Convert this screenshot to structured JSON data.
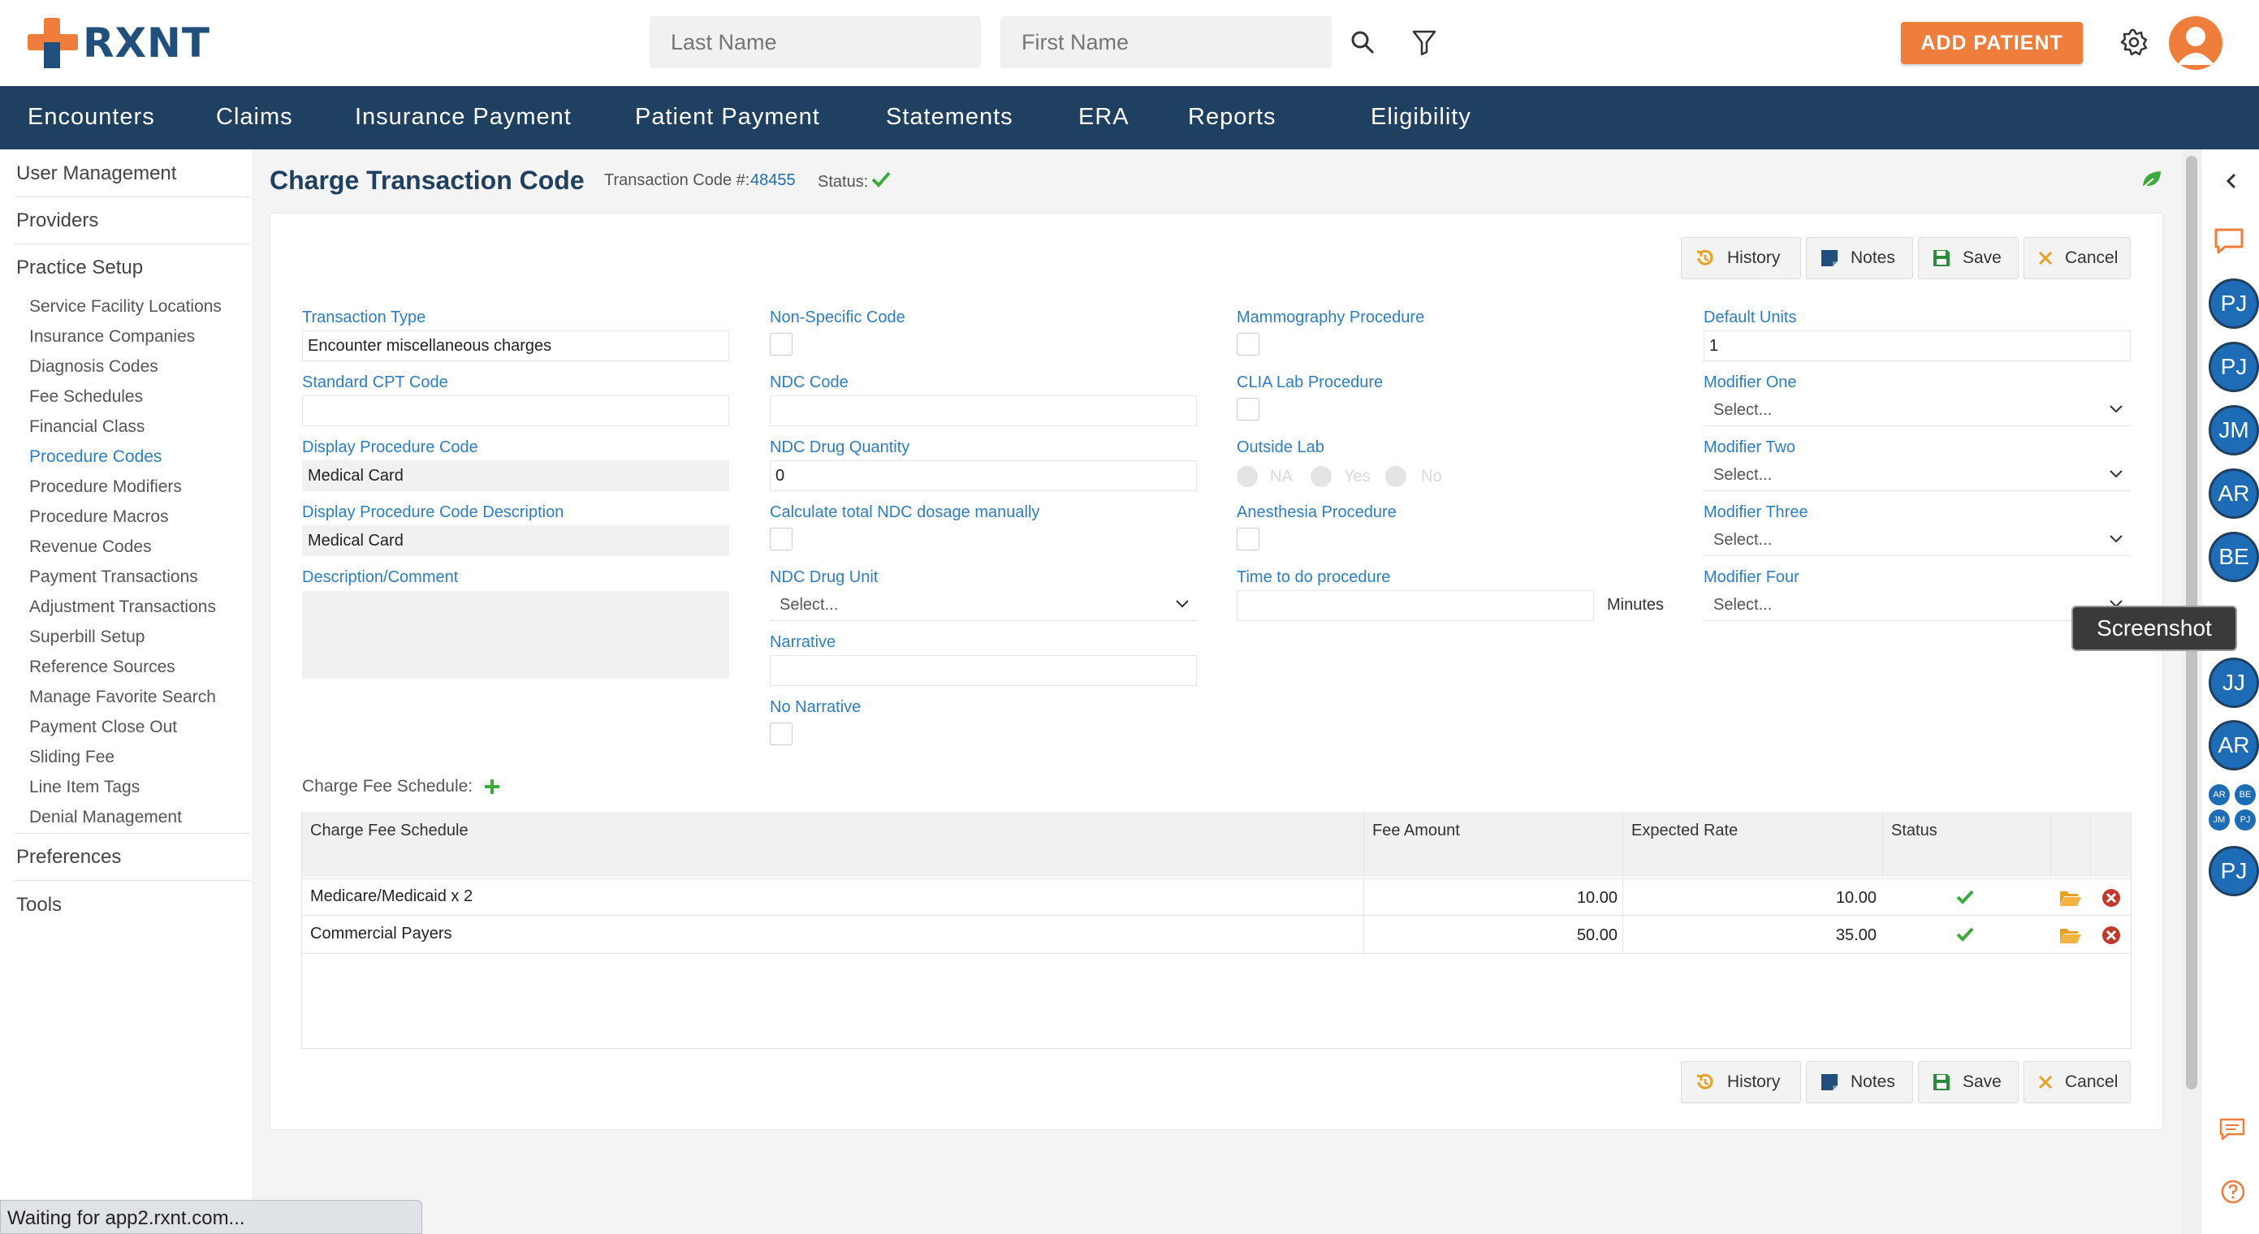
{
  "header": {
    "logo_text": "RXNT",
    "last_name_placeholder": "Last Name",
    "first_name_placeholder": "First Name",
    "add_patient_label": "ADD PATIENT"
  },
  "nav": {
    "items": [
      "Encounters",
      "Claims",
      "Insurance Payment",
      "Patient Payment",
      "Statements",
      "ERA",
      "Reports",
      "Eligibility"
    ]
  },
  "sidebar": {
    "user_management": "User Management",
    "providers": "Providers",
    "practice_setup": "Practice Setup",
    "sub_items": [
      "Service Facility Locations",
      "Insurance Companies",
      "Diagnosis Codes",
      "Fee Schedules",
      "Financial Class",
      "Procedure Codes",
      "Procedure Modifiers",
      "Procedure Macros",
      "Revenue Codes",
      "Payment Transactions",
      "Adjustment Transactions",
      "Superbill Setup",
      "Reference Sources",
      "Manage Favorite Search",
      "Payment Close Out",
      "Sliding Fee",
      "Line Item Tags",
      "Denial Management"
    ],
    "preferences": "Preferences",
    "tools": "Tools"
  },
  "page": {
    "title": "Charge Transaction Code",
    "transaction_code_label": "Transaction Code #:",
    "transaction_code_value": "48455",
    "status_label": "Status:"
  },
  "actions": {
    "history": "History",
    "notes": "Notes",
    "save": "Save",
    "cancel": "Cancel"
  },
  "form": {
    "transaction_type_label": "Transaction Type",
    "transaction_type_value": "Encounter miscellaneous charges",
    "standard_cpt_label": "Standard CPT Code",
    "standard_cpt_value": "",
    "display_proc_code_label": "Display Procedure Code",
    "display_proc_code_value": "Medical Card",
    "display_proc_desc_label": "Display Procedure Code Description",
    "display_proc_desc_value": "Medical Card",
    "description_label": "Description/Comment",
    "non_specific_label": "Non-Specific Code",
    "ndc_code_label": "NDC Code",
    "ndc_qty_label": "NDC Drug Quantity",
    "ndc_qty_value": "0",
    "calc_ndc_label": "Calculate total NDC dosage manually",
    "ndc_unit_label": "NDC Drug Unit",
    "ndc_unit_value": "Select...",
    "narrative_label": "Narrative",
    "no_narrative_label": "No Narrative",
    "mammo_label": "Mammography Procedure",
    "clia_label": "CLIA Lab Procedure",
    "outside_lab_label": "Outside Lab",
    "outside_lab_options": [
      "NA",
      "Yes",
      "No"
    ],
    "anesthesia_label": "Anesthesia Procedure",
    "time_label": "Time to do procedure",
    "minutes_label": "Minutes",
    "default_units_label": "Default Units",
    "default_units_value": "1",
    "modifier_one_label": "Modifier One",
    "modifier_two_label": "Modifier Two",
    "modifier_three_label": "Modifier Three",
    "modifier_four_label": "Modifier Four",
    "select_placeholder": "Select..."
  },
  "fee_schedule": {
    "section_label": "Charge Fee Schedule:",
    "columns": [
      "Charge Fee Schedule",
      "Fee Amount",
      "Expected Rate",
      "Status"
    ],
    "rows": [
      {
        "name": "Medicare/Medicaid x 2",
        "fee": "10.00",
        "expected": "10.00"
      },
      {
        "name": "Commercial Payers",
        "fee": "50.00",
        "expected": "35.00"
      }
    ]
  },
  "right_panel": {
    "avatars": [
      "PJ",
      "PJ",
      "JM",
      "AR",
      "BE",
      "JJ",
      "AR",
      "PJ"
    ],
    "mini_avatars": [
      "AR",
      "BE",
      "JM",
      "PJ"
    ],
    "tooltip": "Screenshot"
  },
  "status_bar": "Waiting for app2.rxnt.com...",
  "colors": {
    "navy": "#1f4060",
    "accent": "#ef7e3c",
    "link": "#2d7dc2",
    "success": "#3cab3c",
    "danger": "#c0392b"
  }
}
